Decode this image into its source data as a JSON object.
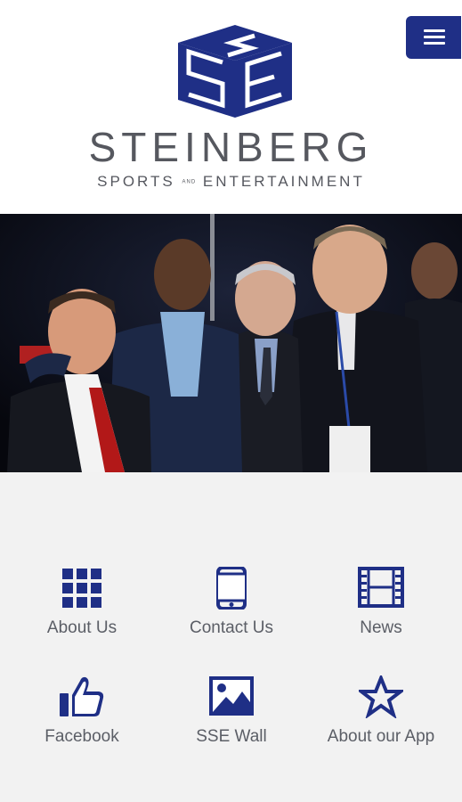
{
  "brand": {
    "name": "STEINBERG",
    "sub_left": "SPORTS",
    "sub_and": "AND",
    "sub_right": "ENTERTAINMENT",
    "colors": {
      "primary": "#1f2f86",
      "text": "#5b5e66"
    }
  },
  "menu": {
    "icon": "hamburger-menu-icon"
  },
  "photo": {
    "description": "Group photo"
  },
  "tiles": [
    {
      "label": "About Us",
      "icon": "grid-icon"
    },
    {
      "label": "Contact Us",
      "icon": "phone-icon"
    },
    {
      "label": "News",
      "icon": "film-icon"
    },
    {
      "label": "Facebook",
      "icon": "thumbs-up-icon"
    },
    {
      "label": "SSE Wall",
      "icon": "image-icon"
    },
    {
      "label": "About our App",
      "icon": "star-icon"
    }
  ]
}
